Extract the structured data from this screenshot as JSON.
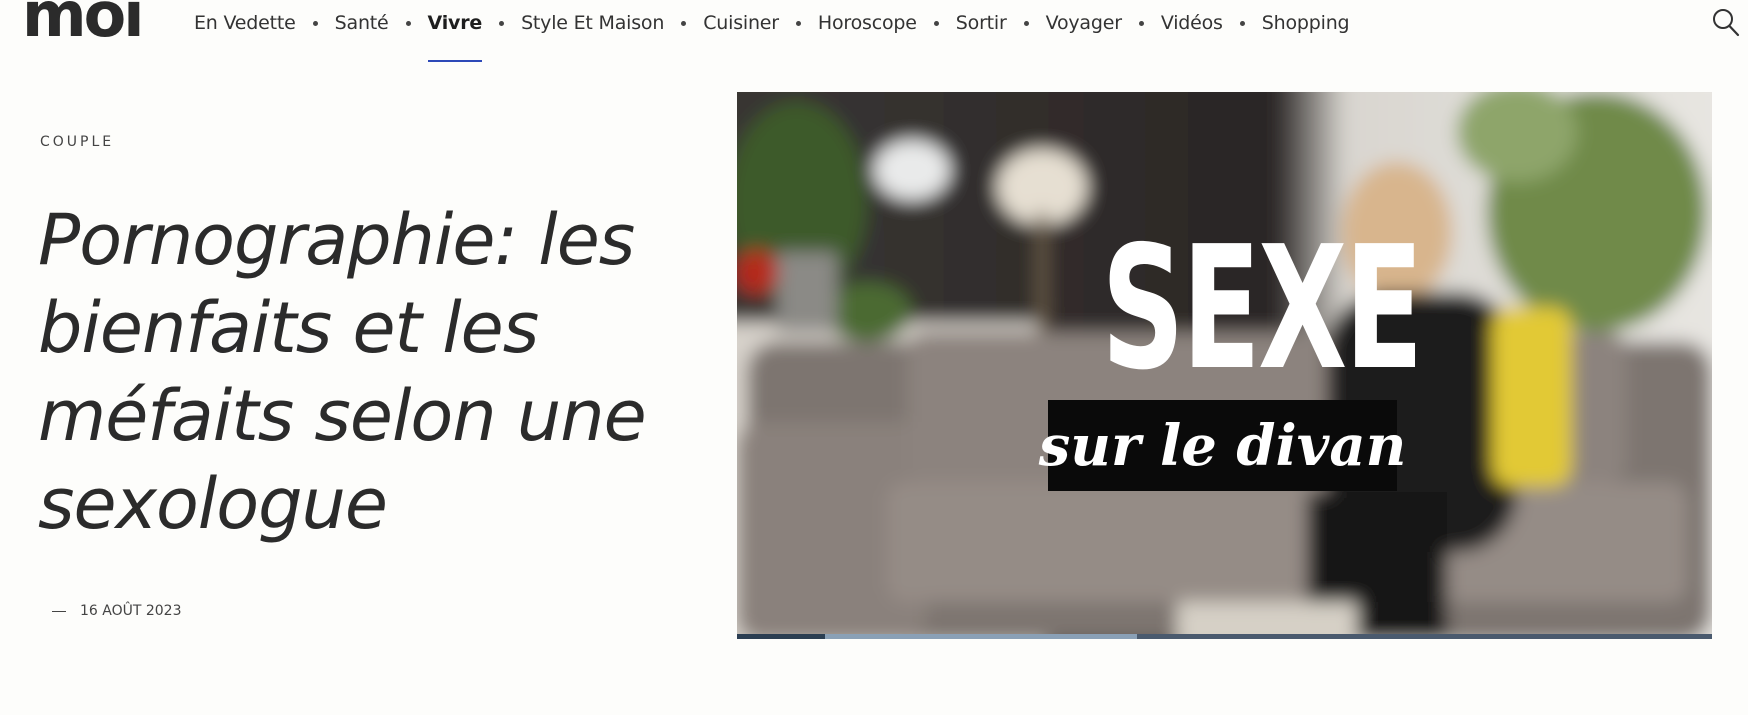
{
  "logo": {
    "text": "moi"
  },
  "nav": {
    "items": [
      {
        "label": "En Vedette",
        "active": false
      },
      {
        "label": "Santé",
        "active": false
      },
      {
        "label": "Vivre",
        "active": true
      },
      {
        "label": "Style Et Maison",
        "active": false
      },
      {
        "label": "Cuisiner",
        "active": false
      },
      {
        "label": "Horoscope",
        "active": false
      },
      {
        "label": "Sortir",
        "active": false
      },
      {
        "label": "Voyager",
        "active": false
      },
      {
        "label": "Vidéos",
        "active": false
      },
      {
        "label": "Shopping",
        "active": false
      }
    ],
    "accent_color": "#2d49b8"
  },
  "search": {
    "icon": "search-icon"
  },
  "article": {
    "category": "COUPLE",
    "title": "Pornographie: les bienfaits et les méfaits selon une sexologue",
    "date": "16 AOÛT 2023"
  },
  "video": {
    "title_main": "SEXE",
    "title_sub": "sur le divan",
    "progress_played": 0.09,
    "progress_buffered": 0.41
  }
}
